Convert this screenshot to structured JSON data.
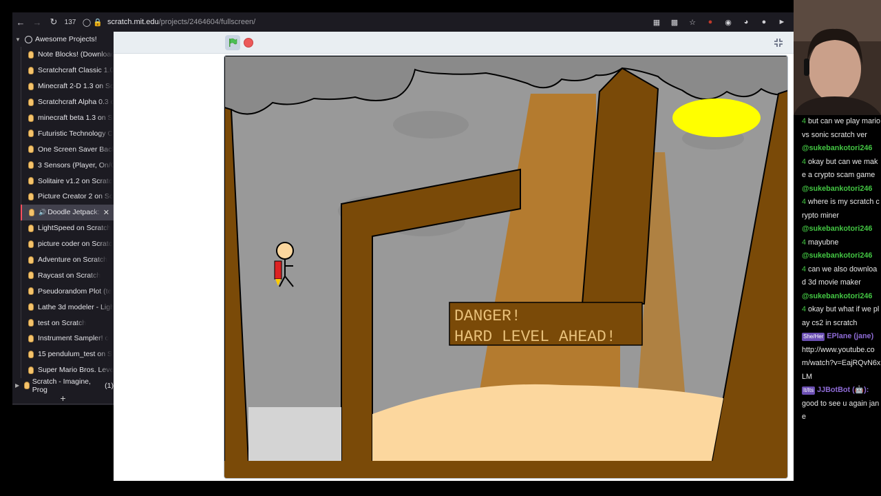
{
  "browser": {
    "tab_count": "137",
    "url_host": "scratch.mit.edu",
    "url_path": "/projects/2464604/fullscreen/"
  },
  "sidebar": {
    "group_title": "Awesome Projects!",
    "items": [
      {
        "label": "Note Blocks! (Download"
      },
      {
        "label": "Scratchcraft Classic 1.0"
      },
      {
        "label": "Minecraft 2-D 1.3 on Sc"
      },
      {
        "label": "Scratchcraft Alpha 0.3 o"
      },
      {
        "label": "minecraft beta 1.3 on S"
      },
      {
        "label": "Futuristic Technology C"
      },
      {
        "label": "One Screen Saver Back"
      },
      {
        "label": "3 Sensors (Player, On/O"
      },
      {
        "label": "Solitaire v1.2 on Scratc"
      },
      {
        "label": "Picture Creator 2 on Sc"
      },
      {
        "label": "Doodle Jetpack: I"
      },
      {
        "label": "LightSpeed on Scratch"
      },
      {
        "label": "picture coder on Scratc"
      },
      {
        "label": "Adventure on Scratch"
      },
      {
        "label": "Raycast on Scratch"
      },
      {
        "label": "Pseudorandom Plot (te"
      },
      {
        "label": "Lathe 3d modeler - Ligh"
      },
      {
        "label": "test on Scratch"
      },
      {
        "label": "Instrument Sampler! o"
      },
      {
        "label": "15 pendulum_test on S"
      },
      {
        "label": "Super Mario Bros. Leve"
      }
    ],
    "other_group": "Scratch - Imagine, Prog",
    "other_group_count": "(1)"
  },
  "stage": {
    "sign_line1": "DANGER!",
    "sign_line2": "HARD LEVEL AHEAD!"
  },
  "chat": [
    {
      "user": "",
      "badge": "",
      "text": "but can we play mario vs sonic scratch ver"
    },
    {
      "user": "@sukebankotori246",
      "badge": "",
      "text": "okay but can we make a crypto scam game"
    },
    {
      "user": "@sukebankotori246",
      "badge": "",
      "text": "where is my scratch crypto miner"
    },
    {
      "user": "@sukebankotori246",
      "badge": "",
      "text": "mayubne"
    },
    {
      "user": "@sukebankotori246",
      "badge": "",
      "text": "can we also download 3d movie maker"
    },
    {
      "user": "@sukebankotori246",
      "badge": "",
      "text": "okay but what if we play cs2 in scratch"
    },
    {
      "user": "EPlane (jane)",
      "badge": "She/Her",
      "text": "http://www.youtube.com/watch?v=EajRQvN6xLM"
    },
    {
      "user": "JJBotBot (🤖):",
      "badge": "It/Its",
      "text": "good to see u again jane"
    }
  ],
  "colors": {
    "accent_active_tab": "#ff4f5e",
    "chat_green": "#43c743",
    "chat_purple": "#8e6bd6"
  }
}
